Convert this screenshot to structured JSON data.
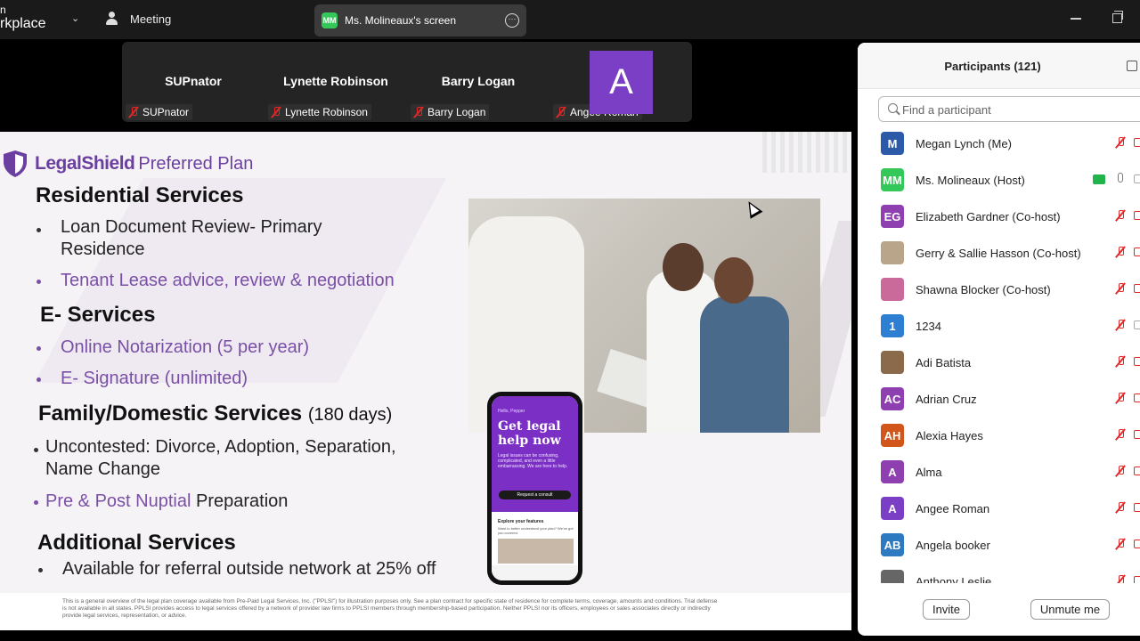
{
  "app": {
    "brand_line1": "n",
    "brand_line2": "rkplace"
  },
  "topbar": {
    "meeting_label": "Meeting",
    "screen_share": {
      "initials": "MM",
      "label": "Ms. Molineaux's screen"
    }
  },
  "gallery": [
    {
      "name": "SUPnator",
      "label": "SUPnator"
    },
    {
      "name": "Lynette Robinson",
      "label": "Lynette Robinson"
    },
    {
      "name": "Barry Logan",
      "label": "Barry Logan"
    },
    {
      "avatar": "A",
      "label": "Angee Roman",
      "avatar_color": "#7b3fc6"
    }
  ],
  "slide": {
    "logo_name": "LegalShield",
    "logo_suffix": "Preferred Plan",
    "residential": {
      "heading": "Residential Services",
      "items": [
        "Loan Document Review- Primary",
        "Residence",
        "Tenant Lease advice, review & negotiation"
      ]
    },
    "eservices": {
      "heading": "E- Services",
      "items": [
        "Online Notarization (5 per year)",
        "E- Signature (unlimited)"
      ]
    },
    "family": {
      "heading": "Family/Domestic Services",
      "days": "(180 days)",
      "items": [
        "Uncontested: Divorce, Adoption, Separation,",
        "Name Change",
        "Pre & Post Nuptial",
        "Preparation"
      ]
    },
    "additional": {
      "heading": "Additional Services",
      "items": [
        "Available for referral outside network at 25% off"
      ]
    },
    "phone": {
      "hi": "Hello, Pepper",
      "headline": "Get legal help now",
      "body": "Legal issues can be confusing, complicated, and even a little embarrassing. We are here to help.",
      "button": "Request a consult",
      "explore": "Explore your features",
      "explore_sub": "Want to better understand your plan? We've got you covered."
    },
    "footer": "This is a general overview of the legal plan coverage available from Pre-Paid Legal Services, Inc. (\"PPLSI\") for illustration purposes only. See a plan contract for specific state of residence for complete terms, coverage, amounts and conditions. Trial defense is not available in all states. PPLSI provides access to legal services offered by a network of provider law firms to PPLSI members through membership-based participation. Neither PPLSI nor its officers, employees or sales associates directly or indirectly provide legal services, representation, or advice."
  },
  "participants": {
    "title": "Participants (121)",
    "search_placeholder": "Find a participant",
    "list": [
      {
        "initials": "M",
        "color": "#2d5aa8",
        "name": "Megan Lynch (Me)"
      },
      {
        "initials": "MM",
        "color": "#34c759",
        "name": "Ms. Molineaux (Host)"
      },
      {
        "initials": "EG",
        "color": "#8e3fb0",
        "name": "Elizabeth Gardner (Co-host)"
      },
      {
        "initials": "",
        "color": "#b8a58a",
        "name": "Gerry & Sallie Hasson (Co-host)"
      },
      {
        "initials": "",
        "color": "#c96a9a",
        "name": "Shawna Blocker (Co-host)"
      },
      {
        "initials": "1",
        "color": "#2e7fd1",
        "name": "1234"
      },
      {
        "initials": "",
        "color": "#8a6a4a",
        "name": "Adi Batista"
      },
      {
        "initials": "AC",
        "color": "#8e3fb0",
        "name": "Adrian Cruz"
      },
      {
        "initials": "AH",
        "color": "#d2561a",
        "name": "Alexia Hayes"
      },
      {
        "initials": "A",
        "color": "#8e3fb0",
        "name": "Alma"
      },
      {
        "initials": "A",
        "color": "#7b3fc6",
        "name": "Angee Roman"
      },
      {
        "initials": "AB",
        "color": "#2d7ac0",
        "name": "Angela booker"
      },
      {
        "initials": "",
        "color": "#666666",
        "name": "Anthony Leslie"
      }
    ],
    "invite": "Invite",
    "unmute": "Unmute me"
  }
}
